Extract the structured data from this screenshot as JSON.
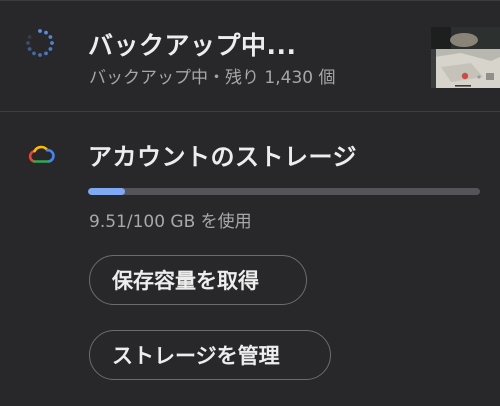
{
  "backup": {
    "title": "バックアップ中...",
    "subtitle": "バックアップ中・残り 1,430 個",
    "spinner_icon": "sync-spinner-icon",
    "thumbnail_icon": "photo-thumbnail"
  },
  "storage": {
    "icon": "cloud-icon",
    "title": "アカウントのストレージ",
    "usage_text": "9.51/100 GB を使用",
    "used_gb": 9.51,
    "total_gb": 100,
    "used_fraction": 0.0951,
    "bar_fill_color": "#7fa9f4",
    "get_storage_label": "保存容量を取得",
    "manage_storage_label": "ストレージを管理"
  },
  "colors": {
    "background": "#28282b",
    "accent_blue": "#7fa9f4"
  }
}
